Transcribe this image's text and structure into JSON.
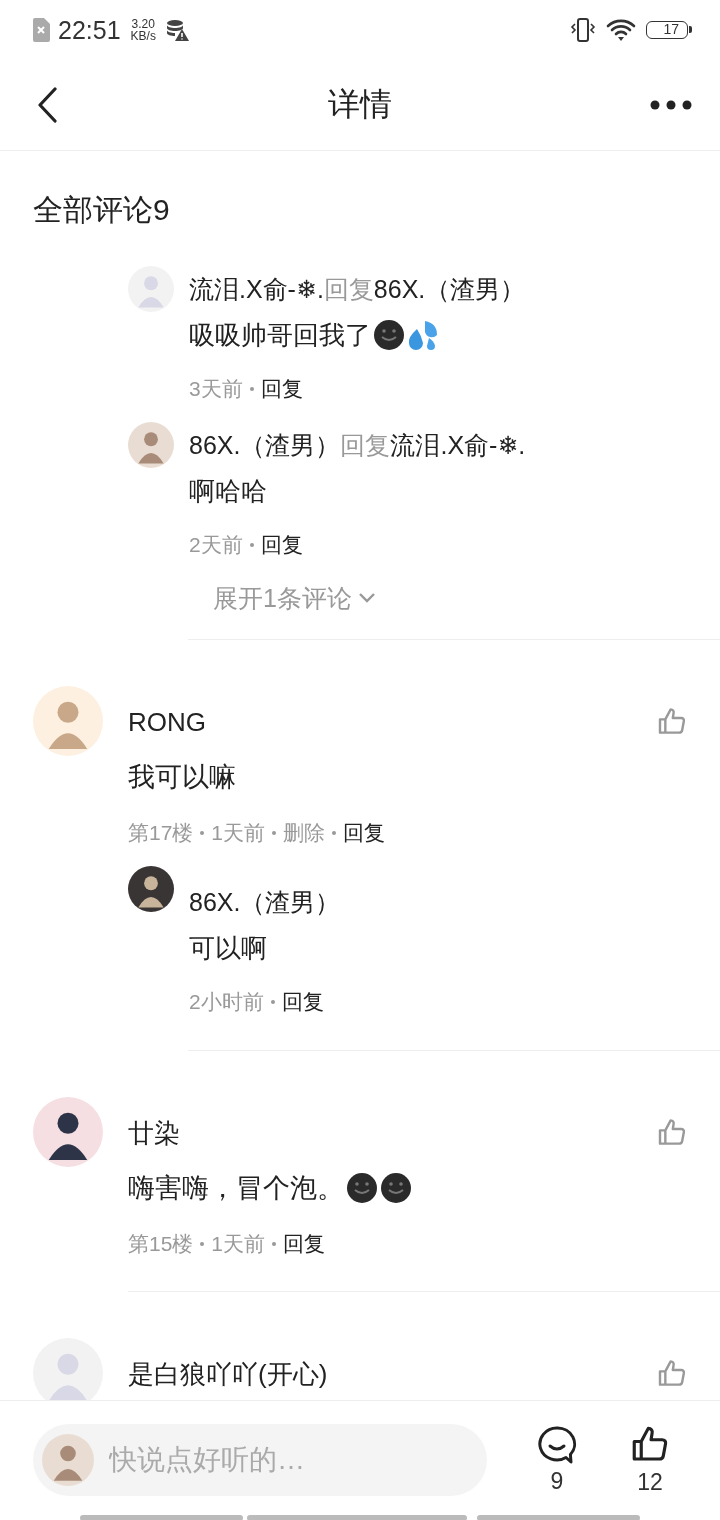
{
  "status_bar": {
    "time": "22:51",
    "net_speed": "3.20",
    "net_speed_unit": "KB/s",
    "battery": "17"
  },
  "header": {
    "title": "详情"
  },
  "comments_heading": "全部评论9",
  "threads": [
    {
      "kind": "replies_only",
      "replies": [
        {
          "author": "流泪.X俞-❄.",
          "reply_word": "回复",
          "target": "86X.（渣男）",
          "text": "吸吸帅哥回我了",
          "emojis": [
            {
              "kind": "smile"
            },
            {
              "kind": "sweat"
            }
          ],
          "meta": [
            {
              "kind": "info",
              "text": "3天前"
            },
            {
              "kind": "action",
              "text": "回复"
            }
          ]
        },
        {
          "author": "86X.（渣男）",
          "reply_word": "回复",
          "target": "流泪.X俞-❄.",
          "text": "啊哈哈",
          "meta": [
            {
              "kind": "info",
              "text": "2天前"
            },
            {
              "kind": "action",
              "text": "回复"
            }
          ]
        }
      ],
      "expand_label": "展开1条评论"
    },
    {
      "kind": "comment",
      "author": "RONG",
      "text": "我可以嘛",
      "meta": [
        {
          "kind": "info",
          "text": "第17楼"
        },
        {
          "kind": "info",
          "text": "1天前"
        },
        {
          "kind": "info",
          "text": "删除"
        },
        {
          "kind": "action",
          "text": "回复"
        }
      ],
      "replies": [
        {
          "author": "86X.（渣男）",
          "text": "可以啊",
          "meta": [
            {
              "kind": "info",
              "text": "2小时前"
            },
            {
              "kind": "action",
              "text": "回复"
            }
          ]
        }
      ]
    },
    {
      "kind": "comment",
      "author": "廿染",
      "text": "嗨害嗨，冒个泡。",
      "emojis": [
        {
          "kind": "smile"
        },
        {
          "kind": "smile"
        }
      ],
      "meta": [
        {
          "kind": "info",
          "text": "第15楼"
        },
        {
          "kind": "info",
          "text": "1天前"
        },
        {
          "kind": "action",
          "text": "回复"
        }
      ]
    },
    {
      "kind": "comment",
      "author": "是白狼吖吖(开心)"
    }
  ],
  "bottom_bar": {
    "placeholder": "快说点好听的…",
    "comment_count": "9",
    "like_count": "12"
  }
}
